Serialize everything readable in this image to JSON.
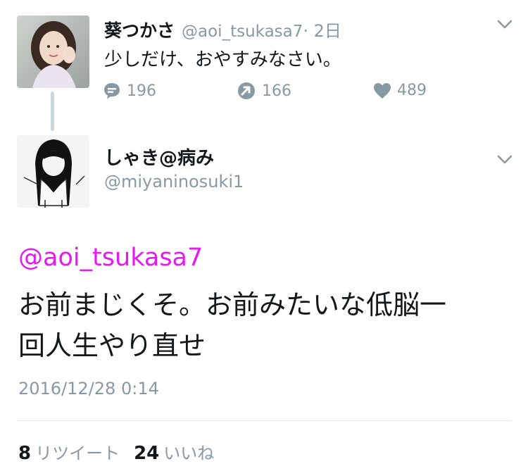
{
  "parent_tweet": {
    "display_name": "葵つかさ",
    "handle": "@aoi_tsukasa7",
    "time": "· 2日",
    "text": "少しだけ、おやすみなさい。",
    "replies": "196",
    "retweets": "166",
    "likes": "489"
  },
  "reply_tweet": {
    "display_name": "しゃき@病み",
    "handle": "@miyaninosuki1",
    "mention": "@aoi_tsukasa7",
    "text_line1": "お前まじくそ。お前みたいな低脳一",
    "text_line2": "回人生やり直せ",
    "timestamp": "2016/12/28 0:14",
    "retweet_count": "8",
    "retweet_label": "リツイート",
    "like_count": "24",
    "like_label": "いいね"
  },
  "colors": {
    "mention": "#e61af0",
    "muted": "#8899a6",
    "divider": "#e1e8ed"
  },
  "icons": [
    "caret-down-icon",
    "reply-icon",
    "retweet-icon",
    "heart-icon"
  ]
}
